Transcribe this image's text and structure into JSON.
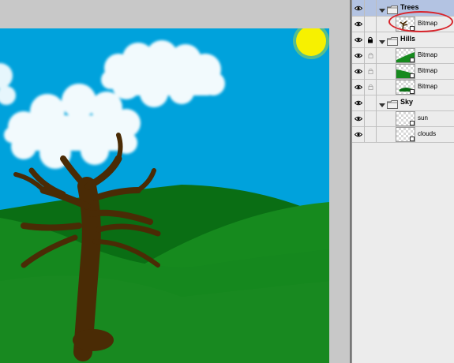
{
  "colors": {
    "sky": "#00a2dc",
    "sun": "#f7f200",
    "hill_dark": "#0a6e14",
    "hill_light": "#168a1e",
    "trunk": "#4a2b05",
    "panel_bg": "#ececec",
    "selection": "#b3c3e2",
    "highlight": "#d8232a"
  },
  "layers_panel": {
    "layers": [
      {
        "kind": "group",
        "name": "Trees",
        "expanded": true,
        "selected": true,
        "eye": true,
        "locked": false
      },
      {
        "kind": "layer",
        "name": "Bitmap",
        "thumb": "tree",
        "eye": true,
        "locked": false,
        "highlighted": true
      },
      {
        "kind": "group",
        "name": "Hills",
        "expanded": true,
        "selected": false,
        "eye": true,
        "locked": true
      },
      {
        "kind": "layer",
        "name": "Bitmap",
        "thumb": "hill-right",
        "eye": true,
        "locked": true
      },
      {
        "kind": "layer",
        "name": "Bitmap",
        "thumb": "hill-left",
        "eye": true,
        "locked": true
      },
      {
        "kind": "layer",
        "name": "Bitmap",
        "thumb": "hill-small",
        "eye": true,
        "locked": true
      },
      {
        "kind": "group",
        "name": "Sky",
        "expanded": true,
        "selected": false,
        "eye": true,
        "locked": false
      },
      {
        "kind": "layer",
        "name": "sun",
        "thumb": "empty",
        "eye": true,
        "locked": false
      },
      {
        "kind": "layer",
        "name": "clouds",
        "thumb": "empty",
        "eye": true,
        "locked": false
      }
    ]
  }
}
